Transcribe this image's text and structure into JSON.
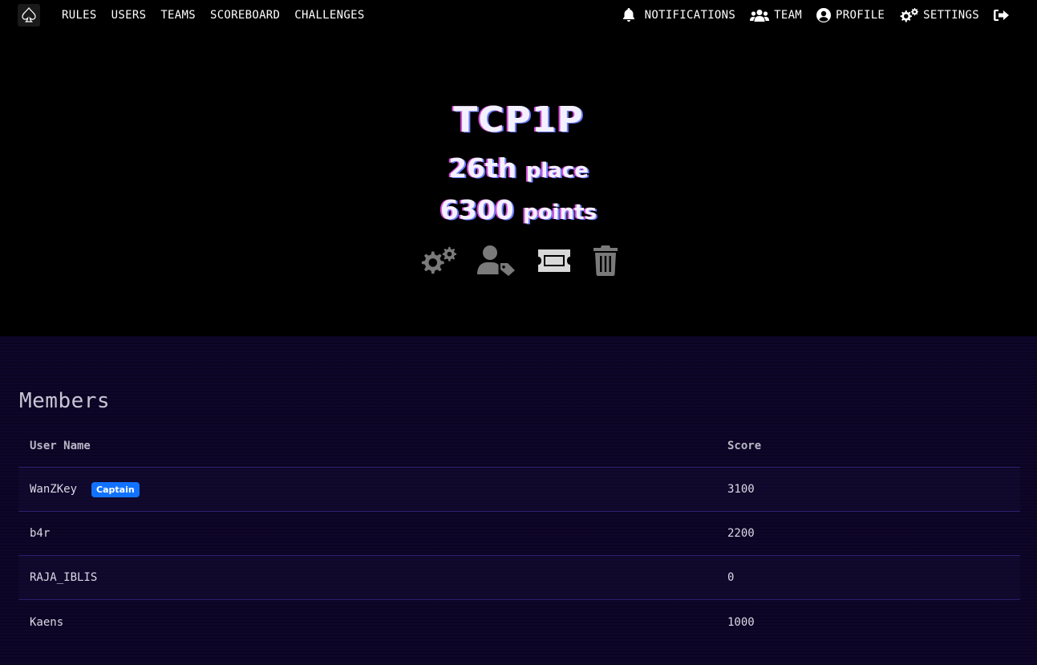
{
  "nav": {
    "left": [
      "RULES",
      "USERS",
      "TEAMS",
      "SCOREBOARD",
      "CHALLENGES"
    ],
    "right": {
      "notifications": "NOTIFICATIONS",
      "team": "TEAM",
      "profile": "PROFILE",
      "settings": "SETTINGS"
    }
  },
  "hero": {
    "team_name": "TCP1P",
    "place_value": "26th",
    "place_label": "place",
    "points_value": "6300",
    "points_label": "points",
    "action_icons": [
      "gears-icon",
      "user-tag-icon",
      "ticket-icon",
      "trash-icon"
    ]
  },
  "members": {
    "title": "Members",
    "columns": [
      "User Name",
      "Score"
    ],
    "rows": [
      {
        "name": "WanZKey",
        "badge": "Captain",
        "score": "3100"
      },
      {
        "name": "b4r",
        "badge": "",
        "score": "2200"
      },
      {
        "name": "RAJA_IBLIS",
        "badge": "",
        "score": "0"
      },
      {
        "name": "Kaens",
        "badge": "",
        "score": "1000"
      }
    ]
  },
  "colors": {
    "background": "#000000",
    "members_bg": "#0b0422",
    "badge": "#1172ff",
    "glitch_pink": "#d54fd6",
    "glitch_blue": "#6b7cff"
  }
}
